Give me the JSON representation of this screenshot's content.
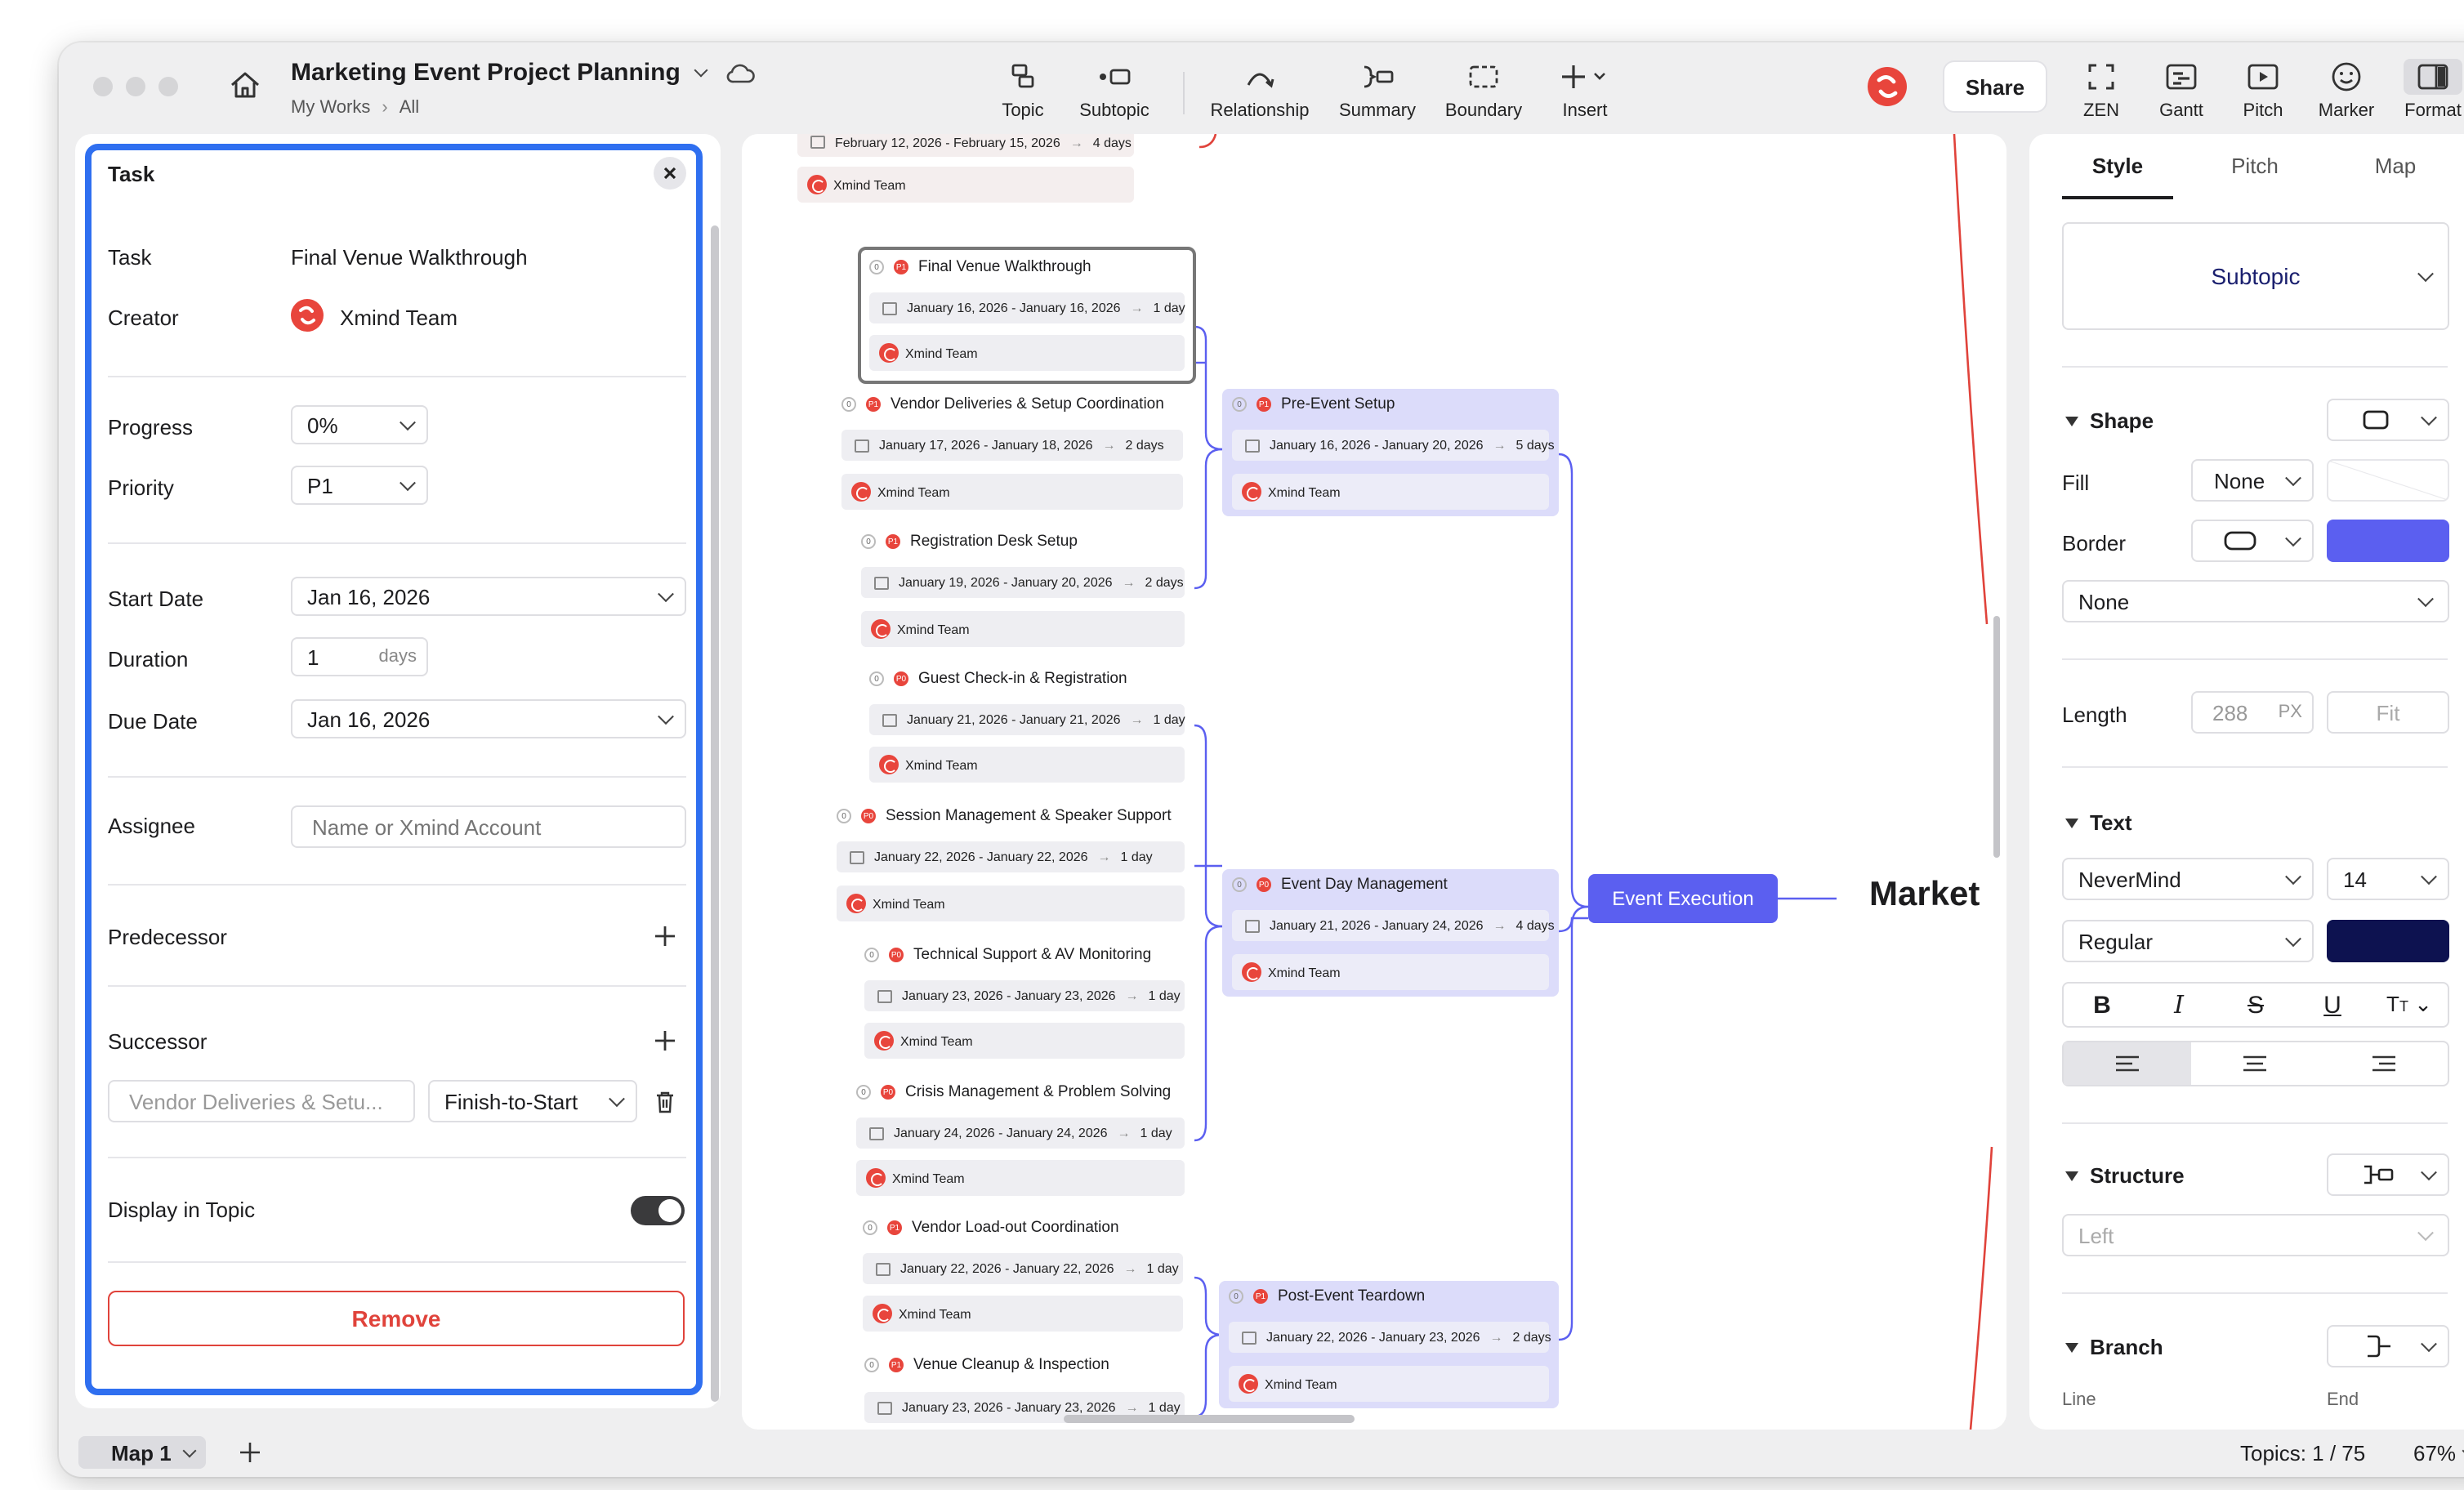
{
  "window": {
    "title": "Marketing Event Project Planning",
    "breadcrumb": [
      "My Works",
      "All"
    ]
  },
  "toolbar": {
    "items": [
      {
        "label": "Topic",
        "icon": "topic-icon"
      },
      {
        "label": "Subtopic",
        "icon": "subtopic-icon"
      },
      {
        "label": "Relationship",
        "icon": "relationship-icon"
      },
      {
        "label": "Summary",
        "icon": "summary-icon"
      },
      {
        "label": "Boundary",
        "icon": "boundary-icon"
      },
      {
        "label": "Insert",
        "icon": "plus-icon"
      }
    ],
    "share_label": "Share",
    "right_items": [
      {
        "label": "ZEN",
        "icon": "zen-icon"
      },
      {
        "label": "Gantt",
        "icon": "gantt-icon"
      },
      {
        "label": "Pitch",
        "icon": "pitch-icon"
      },
      {
        "label": "Marker",
        "icon": "marker-icon"
      },
      {
        "label": "Format",
        "icon": "format-icon"
      }
    ]
  },
  "task_panel": {
    "header": "Task",
    "task_label": "Task",
    "task_value": "Final Venue Walkthrough",
    "creator_label": "Creator",
    "creator_value": "Xmind Team",
    "progress_label": "Progress",
    "progress_value": "0%",
    "priority_label": "Priority",
    "priority_value": "P1",
    "start_label": "Start Date",
    "start_value": "Jan 16, 2026",
    "duration_label": "Duration",
    "duration_value": "1",
    "duration_unit": "days",
    "due_label": "Due Date",
    "due_value": "Jan 16, 2026",
    "assignee_label": "Assignee",
    "assignee_placeholder": "Name or Xmind Account",
    "predecessor_label": "Predecessor",
    "successor_label": "Successor",
    "successor_task": "Vendor Deliveries & Setu...",
    "successor_type": "Finish-to-Start",
    "display_label": "Display in Topic",
    "display_on": true,
    "remove_label": "Remove"
  },
  "canvas": {
    "top_fragment": {
      "date": "February 12, 2026 - February 15, 2026",
      "duration": "4 days",
      "assignee": "Xmind Team"
    },
    "tasks": [
      {
        "title": "Final Venue Walkthrough",
        "priority": "P1",
        "date": "January 16, 2026 - January 16, 2026",
        "duration": "1 day",
        "assignee": "Xmind Team"
      },
      {
        "title": "Vendor Deliveries & Setup Coordination",
        "priority": "P1",
        "count": "0",
        "date": "January 17, 2026 - January 18, 2026",
        "duration": "2 days",
        "assignee": "Xmind Team"
      },
      {
        "title": "Registration Desk Setup",
        "priority": "P1",
        "count": "0",
        "date": "January 19, 2026 - January 20, 2026",
        "duration": "2 days",
        "assignee": "Xmind Team"
      },
      {
        "title": "Guest Check-in & Registration",
        "priority": "P0",
        "count": "0",
        "date": "January 21, 2026 - January 21, 2026",
        "duration": "1 day",
        "assignee": "Xmind Team"
      },
      {
        "title": "Session Management & Speaker Support",
        "priority": "P0",
        "count": "0",
        "date": "January 22, 2026 - January 22, 2026",
        "duration": "1 day",
        "assignee": "Xmind Team"
      },
      {
        "title": "Technical Support & AV Monitoring",
        "priority": "P0",
        "count": "0",
        "date": "January 23, 2026 - January 23, 2026",
        "duration": "1 day",
        "assignee": "Xmind Team"
      },
      {
        "title": "Crisis Management & Problem Solving",
        "priority": "P0",
        "count": "0",
        "date": "January 24, 2026 - January 24, 2026",
        "duration": "1 day",
        "assignee": "Xmind Team"
      },
      {
        "title": "Vendor Load-out Coordination",
        "priority": "P1",
        "count": "0",
        "date": "January 22, 2026 - January 22, 2026",
        "duration": "1 day",
        "assignee": "Xmind Team"
      },
      {
        "title": "Venue Cleanup & Inspection",
        "priority": "P1",
        "count": "0",
        "date": "January 23, 2026 - January 23, 2026",
        "duration": "1 day"
      }
    ],
    "groups": [
      {
        "title": "Pre-Event Setup",
        "priority": "P1",
        "count": "0",
        "date": "January 16, 2026 - January 20, 2026",
        "duration": "5 days",
        "assignee": "Xmind Team"
      },
      {
        "title": "Event Day Management",
        "priority": "P0",
        "count": "0",
        "date": "January 21, 2026 - January 24, 2026",
        "duration": "4 days",
        "assignee": "Xmind Team"
      },
      {
        "title": "Post-Event Teardown",
        "priority": "P1",
        "count": "0",
        "date": "January 22, 2026 - January 23, 2026",
        "duration": "2 days",
        "assignee": "Xmind Team"
      }
    ],
    "main_topic": "Event Execution",
    "central_topic": "Market"
  },
  "format_panel": {
    "tabs": [
      "Style",
      "Pitch",
      "Map"
    ],
    "active_tab": "Style",
    "style_value": "Subtopic",
    "shape_label": "Shape",
    "fill_label": "Fill",
    "fill_value": "None",
    "border_label": "Border",
    "border_color": "#5b5ff0",
    "border_style_value": "None",
    "length_label": "Length",
    "length_value": "288",
    "length_unit": "PX",
    "fit_label": "Fit",
    "text_label": "Text",
    "font_value": "NeverMind",
    "size_value": "14",
    "weight_value": "Regular",
    "text_color": "#0d1250",
    "structure_label": "Structure",
    "structure_value": "Left",
    "branch_label": "Branch",
    "line_label": "Line",
    "end_label": "End"
  },
  "statusbar": {
    "map_tab": "Map 1",
    "topics": "Topics: 1 / 75",
    "zoom": "67%"
  },
  "colors": {
    "accent": "#5b5ff0",
    "danger": "#e0433b",
    "panel_focus": "#2f6ff0",
    "group_fill": "#dcdcfa"
  }
}
